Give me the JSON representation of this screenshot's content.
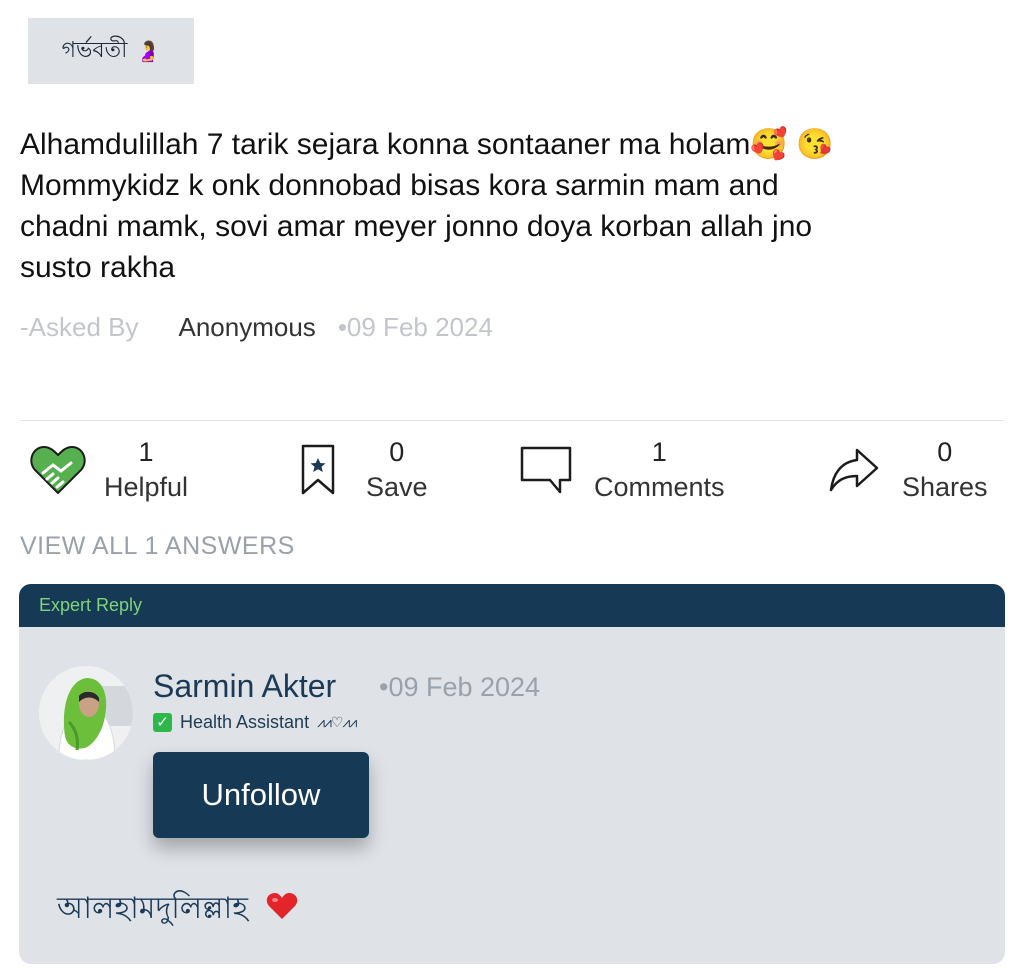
{
  "tag": {
    "label": "গর্ভবতী",
    "emoji": "🤰"
  },
  "post": {
    "lines": [
      "Alhamdulillah 7 tarik sejara  konna sontaaner ma holam🥰 😘",
      "Mommykidz k onk donnobad bisas kora sarmin mam and",
      "chadni mamk, sovi amar meyer jonno doya korban allah jno",
      "susto rakha"
    ],
    "asked_by_label": "-Asked By",
    "author": "Anonymous",
    "date": "•09 Feb 2024"
  },
  "actions": {
    "helpful": {
      "count": "1",
      "label": "Helpful",
      "icon": "handshake-heart-icon"
    },
    "save": {
      "count": "0",
      "label": "Save",
      "icon": "bookmark-star-icon"
    },
    "comments": {
      "count": "1",
      "label": "Comments",
      "icon": "comment-bubble-icon"
    },
    "shares": {
      "count": "0",
      "label": "Shares",
      "icon": "share-arrow-icon"
    }
  },
  "view_all_label": "VIEW ALL 1 ANSWERS",
  "expert_reply": {
    "header": "Expert Reply",
    "name": "Sarmin Akter",
    "date": "•09 Feb 2024",
    "role": "Health Assistant",
    "role_suffix": "⩘⩘♡⩘⩘",
    "follow_button": "Unfollow",
    "answer": "আলহামদুলিল্লাহ"
  },
  "colors": {
    "brand_dark": "#163a56",
    "card_bg": "#dfe3e8",
    "expert_badge_green": "#7fd37a",
    "helpful_green": "#4caf50"
  }
}
